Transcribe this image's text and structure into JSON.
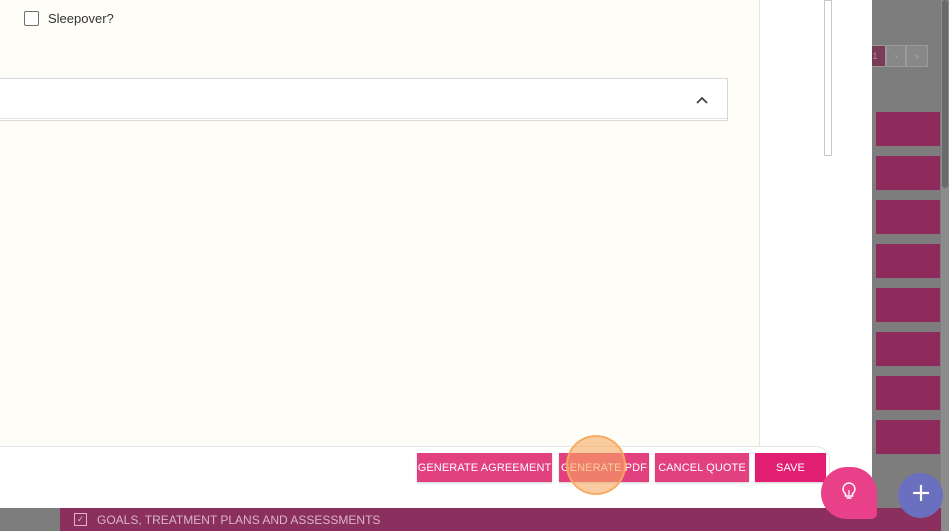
{
  "modal": {
    "sleepover_label": "Sleepover?",
    "sleepover_checked": false,
    "accordion_icon": "chevron-up-icon",
    "buttons": {
      "generate_agreement": "GENERATE AGREEMENT",
      "generate_pdf": "GENERATE PDF",
      "cancel_quote": "CANCEL QUOTE",
      "save": "SAVE"
    }
  },
  "background": {
    "pager": {
      "page": "1",
      "next": "›",
      "last": "»"
    },
    "footer_section": "GOALS, TREATMENT PLANS AND ASSESSMENTS"
  },
  "fabs": {
    "idea_icon": "lightbulb-icon",
    "add_icon": "plus-icon"
  },
  "colors": {
    "primary": "#e21e73",
    "button": "#e3407f",
    "fab_add": "#6b6fbf",
    "bg_row": "#8e2a5c"
  }
}
